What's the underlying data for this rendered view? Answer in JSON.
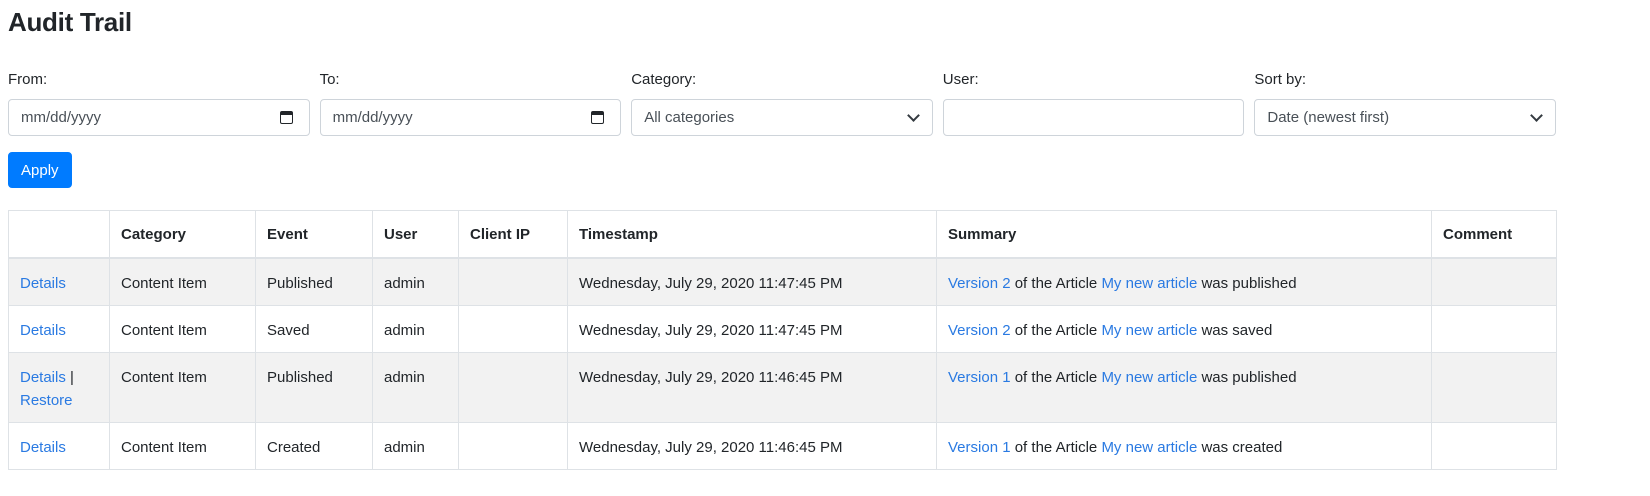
{
  "title": "Audit Trail",
  "filters": {
    "from": {
      "label": "From:",
      "placeholder": "mm/dd/yyyy"
    },
    "to": {
      "label": "To:",
      "placeholder": "mm/dd/yyyy"
    },
    "category": {
      "label": "Category:",
      "selected": "All categories"
    },
    "user": {
      "label": "User:",
      "value": ""
    },
    "sort": {
      "label": "Sort by:",
      "selected": "Date (newest first)"
    },
    "apply_label": "Apply"
  },
  "table": {
    "headers": [
      "",
      "Category",
      "Event",
      "User",
      "Client IP",
      "Timestamp",
      "Summary",
      "Comment"
    ],
    "rows": [
      {
        "details": "Details",
        "restore": "",
        "category": "Content Item",
        "event": "Published",
        "user": "admin",
        "client_ip": "",
        "timestamp": "Wednesday, July 29, 2020 11:47:45 PM",
        "version_link": "Version 2",
        "summary_mid": "of the Article",
        "article_link": "My new article",
        "summary_end": "was published",
        "comment": ""
      },
      {
        "details": "Details",
        "restore": "",
        "category": "Content Item",
        "event": "Saved",
        "user": "admin",
        "client_ip": "",
        "timestamp": "Wednesday, July 29, 2020 11:47:45 PM",
        "version_link": "Version 2",
        "summary_mid": "of the Article",
        "article_link": "My new article",
        "summary_end": "was saved",
        "comment": ""
      },
      {
        "details": "Details",
        "restore": "Restore",
        "category": "Content Item",
        "event": "Published",
        "user": "admin",
        "client_ip": "",
        "timestamp": "Wednesday, July 29, 2020 11:46:45 PM",
        "version_link": "Version 1",
        "summary_mid": "of the Article",
        "article_link": "My new article",
        "summary_end": "was published",
        "comment": ""
      },
      {
        "details": "Details",
        "restore": "",
        "category": "Content Item",
        "event": "Created",
        "user": "admin",
        "client_ip": "",
        "timestamp": "Wednesday, July 29, 2020 11:46:45 PM",
        "version_link": "Version 1",
        "summary_mid": "of the Article",
        "article_link": "My new article",
        "summary_end": "was created",
        "comment": ""
      }
    ]
  },
  "colors": {
    "link": "#2a7ae2",
    "button": "#007bff",
    "stripe": "#f2f2f2"
  }
}
